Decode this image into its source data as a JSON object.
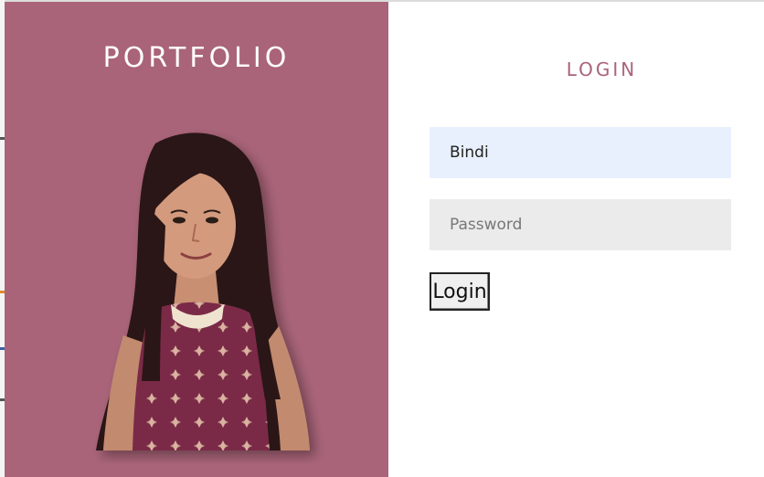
{
  "brand": {
    "title": "PORTFOLIO"
  },
  "login": {
    "heading": "LOGIN",
    "username_value": "Bindi",
    "password_placeholder": "Password",
    "submit_label": "Login"
  },
  "colors": {
    "accent": "#a96479",
    "username_bg": "#e8f0fe",
    "password_bg": "#ebebeb"
  },
  "icons": {
    "profile": "profile-photo"
  }
}
